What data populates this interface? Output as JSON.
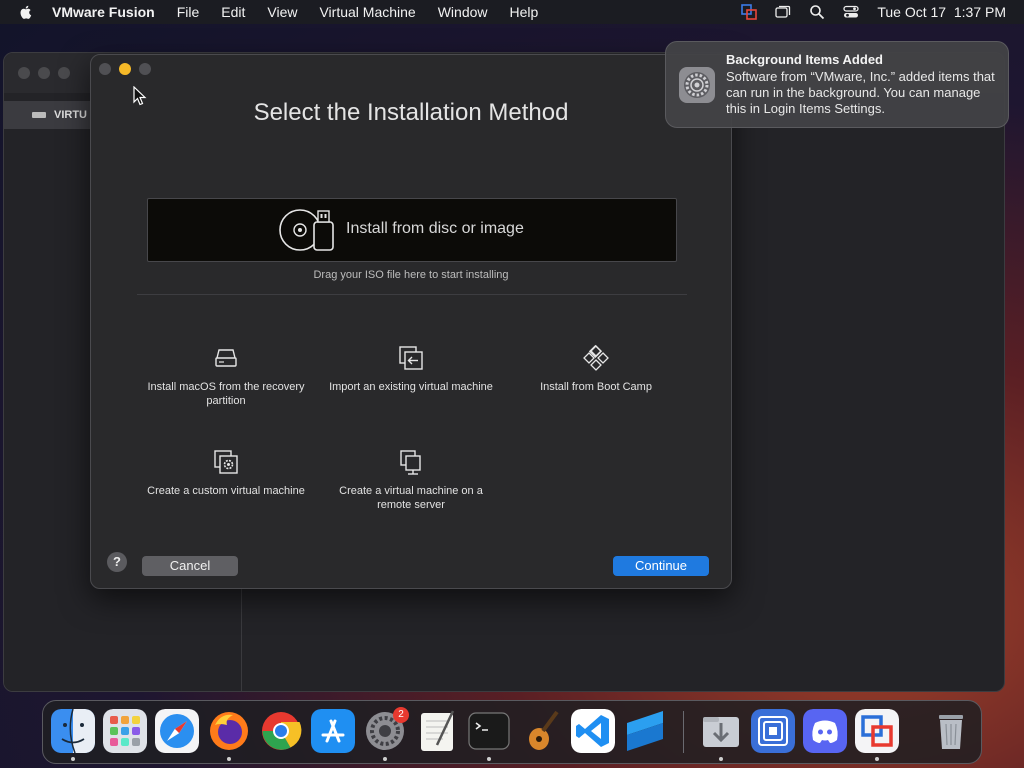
{
  "menubar": {
    "app_name": "VMware Fusion",
    "items": [
      "File",
      "Edit",
      "View",
      "Virtual Machine",
      "Window",
      "Help"
    ],
    "clock": "Tue Oct 17  1:37 PM"
  },
  "background_window": {
    "sidebar_label": "VIRTU"
  },
  "dialog": {
    "title": "Select the Installation Method",
    "dropzone_label": "Install from disc or image",
    "drop_hint": "Drag your ISO file here to start installing",
    "options": [
      {
        "label": "Install macOS from the recovery partition",
        "icon": "hard-drive-icon"
      },
      {
        "label": "Import an existing virtual machine",
        "icon": "import-icon"
      },
      {
        "label": "Install from Boot Camp",
        "icon": "bootcamp-icon"
      },
      {
        "label": "Create a custom virtual machine",
        "icon": "custom-vm-icon"
      },
      {
        "label": "Create a virtual machine on a remote server",
        "icon": "remote-server-icon"
      }
    ],
    "help_label": "?",
    "cancel_label": "Cancel",
    "continue_label": "Continue"
  },
  "notification": {
    "title": "Background Items Added",
    "body": "Software from “VMware, Inc.” added items that can run in the background. You can manage this in Login Items Settings."
  },
  "dock": {
    "settings_badge": "2"
  },
  "colors": {
    "accent": "#1f7ae0",
    "minimize": "#f5b928",
    "badge": "#e8392f"
  }
}
